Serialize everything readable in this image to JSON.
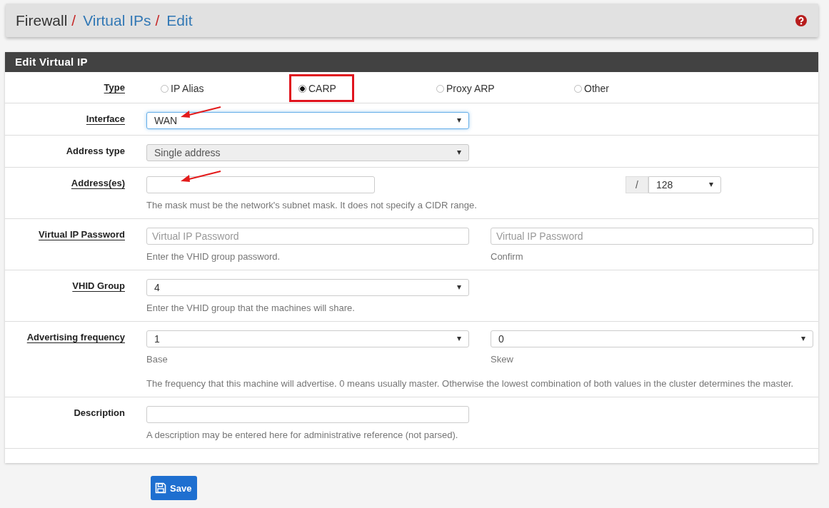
{
  "breadcrumb": [
    {
      "text": "Firewall",
      "kind": "plain",
      "separator": "/"
    },
    {
      "text": "Virtual IPs",
      "kind": "link",
      "separator": "/"
    },
    {
      "text": "Edit",
      "kind": "link"
    }
  ],
  "panel": {
    "title": "Edit Virtual IP",
    "rows": [
      {
        "label": "Type",
        "link": true,
        "kind": "radio",
        "options": [
          {
            "label": "IP Alias",
            "selected": false,
            "highlighted": false
          },
          {
            "label": "CARP",
            "selected": true,
            "highlighted": true
          },
          {
            "label": "Proxy ARP",
            "selected": false,
            "highlighted": false
          },
          {
            "label": "Other",
            "selected": false,
            "highlighted": false
          }
        ]
      },
      {
        "label": "Interface",
        "link": true,
        "kind": "single",
        "control": {
          "kind": "select",
          "value": "WAN",
          "focused": true,
          "disabled": false,
          "annotated": true
        }
      },
      {
        "label": "Address type",
        "link": false,
        "kind": "single",
        "control": {
          "kind": "select",
          "value": "Single address",
          "focused": false,
          "disabled": true,
          "annotated": false
        }
      },
      {
        "label": "Address(es)",
        "link": true,
        "kind": "address",
        "control": {
          "kind": "text",
          "focused": false,
          "disabled": false,
          "annotated": true
        },
        "mask": {
          "prefix": "/",
          "value": "128"
        },
        "help": "The mask must be the network's subnet mask. It does not specify a CIDR range."
      },
      {
        "label": "Virtual IP Password",
        "link": true,
        "kind": "pair",
        "controls": [
          {
            "kind": "text",
            "placeholder": "Virtual IP Password",
            "caption": "Enter the VHID group password."
          },
          {
            "kind": "text",
            "placeholder": "Virtual IP Password",
            "caption": "Confirm"
          }
        ]
      },
      {
        "label": "VHID Group",
        "link": true,
        "kind": "single",
        "control": {
          "kind": "select",
          "value": "4",
          "focused": false,
          "disabled": false,
          "annotated": false
        },
        "help": "Enter the VHID group that the machines will share."
      },
      {
        "label": "Advertising frequency",
        "link": true,
        "kind": "pair",
        "controls": [
          {
            "kind": "select",
            "value": "1",
            "caption": "Base"
          },
          {
            "kind": "select",
            "value": "0",
            "caption": "Skew"
          }
        ],
        "help": "The frequency that this machine will advertise. 0 means usually master. Otherwise the lowest combination of both values in the cluster determines the master."
      },
      {
        "label": "Description",
        "link": false,
        "kind": "single",
        "control": {
          "kind": "text",
          "focused": false,
          "disabled": false,
          "annotated": false
        },
        "help": "A description may be entered here for administrative reference (not parsed)."
      }
    ]
  },
  "save_button": {
    "label": "Save"
  }
}
